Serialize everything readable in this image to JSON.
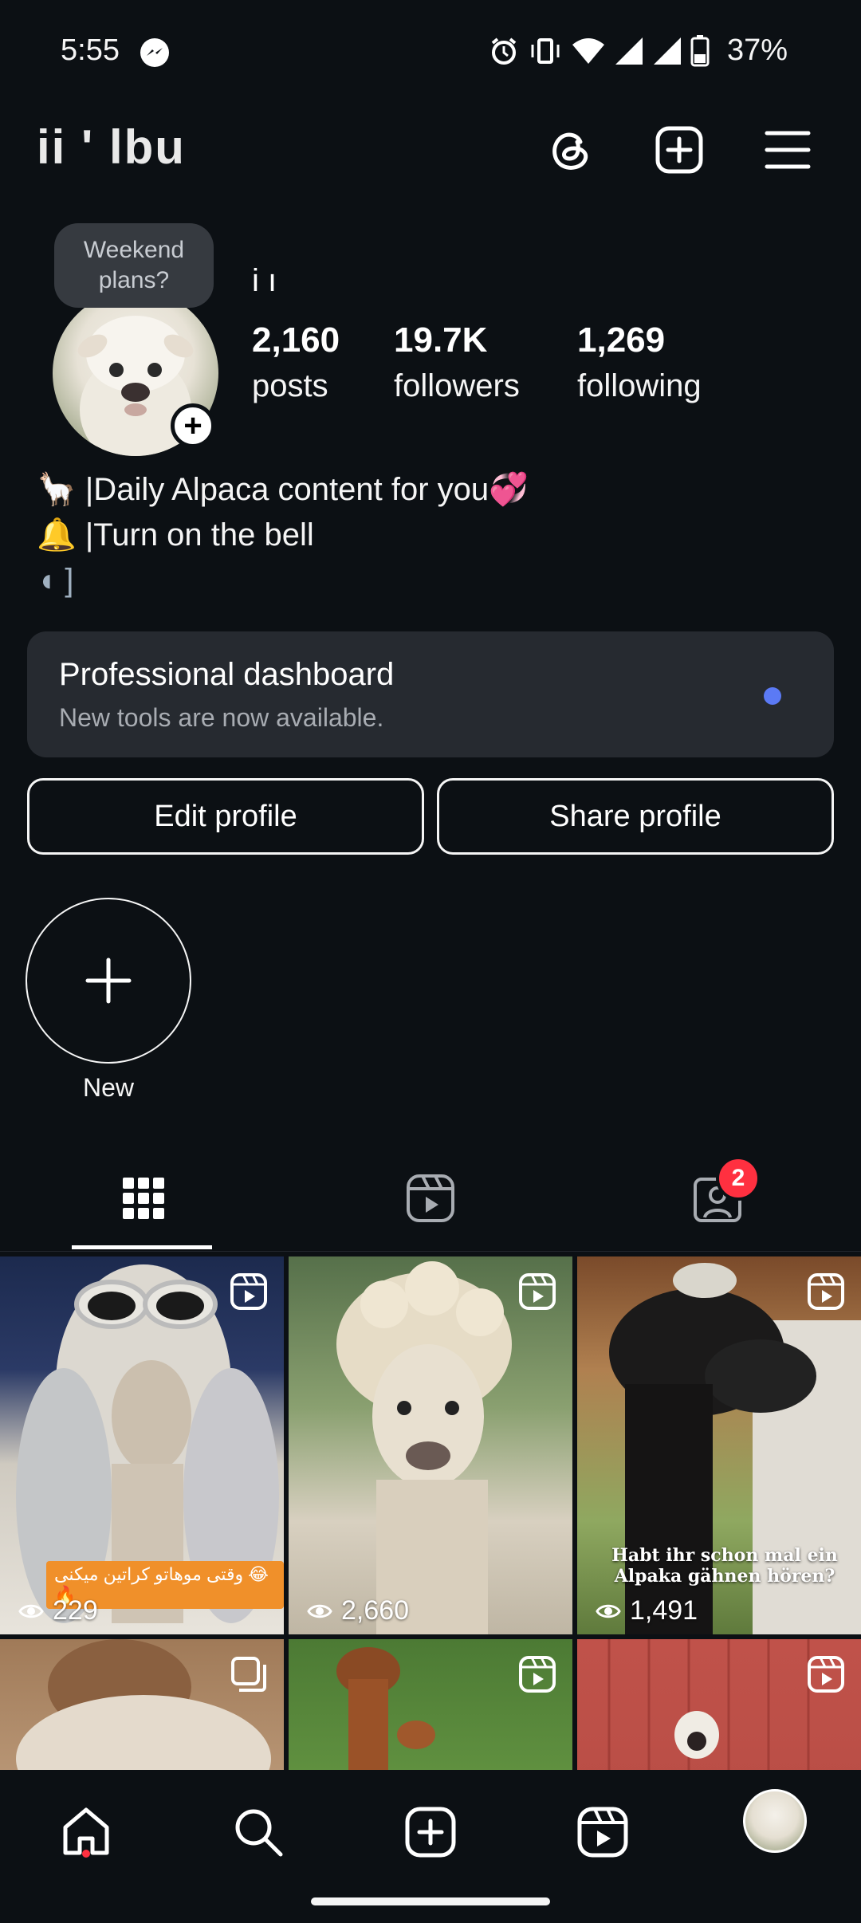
{
  "status": {
    "time": "5:55",
    "battery": "37%"
  },
  "header": {
    "username_partial": "ii  ' lbu"
  },
  "profile": {
    "note": "Weekend plans?",
    "name_partial": "i      ı",
    "stats": [
      {
        "value": "2,160",
        "label": "posts"
      },
      {
        "value": "19.7K",
        "label": "followers"
      },
      {
        "value": "1,269",
        "label": "following"
      }
    ],
    "bio": {
      "line1": "🦙 |Daily Alpaca content for you💞",
      "line2": "🔔 |Turn on the bell",
      "line3": "◖ ]"
    },
    "add_icon": "plus-icon"
  },
  "dashboard": {
    "title": "Professional dashboard",
    "subtitle": "New tools are now available."
  },
  "buttons": {
    "edit": "Edit profile",
    "share": "Share profile"
  },
  "highlight": {
    "new_label": "New"
  },
  "tabs": {
    "tagged_badge": "2"
  },
  "posts": [
    {
      "views": "229",
      "caption": "وقتی موهاتو کراتین میکنی 😂🔥",
      "icon": "reel-icon"
    },
    {
      "views": "2,660",
      "icon": "reel-icon"
    },
    {
      "views": "1,491",
      "caption": "Habt ihr schon mal ein Alpaka gähnen hören?",
      "icon": "reel-icon"
    },
    {
      "icon": "carousel-icon"
    },
    {
      "icon": "reel-icon"
    },
    {
      "icon": "reel-icon"
    }
  ]
}
